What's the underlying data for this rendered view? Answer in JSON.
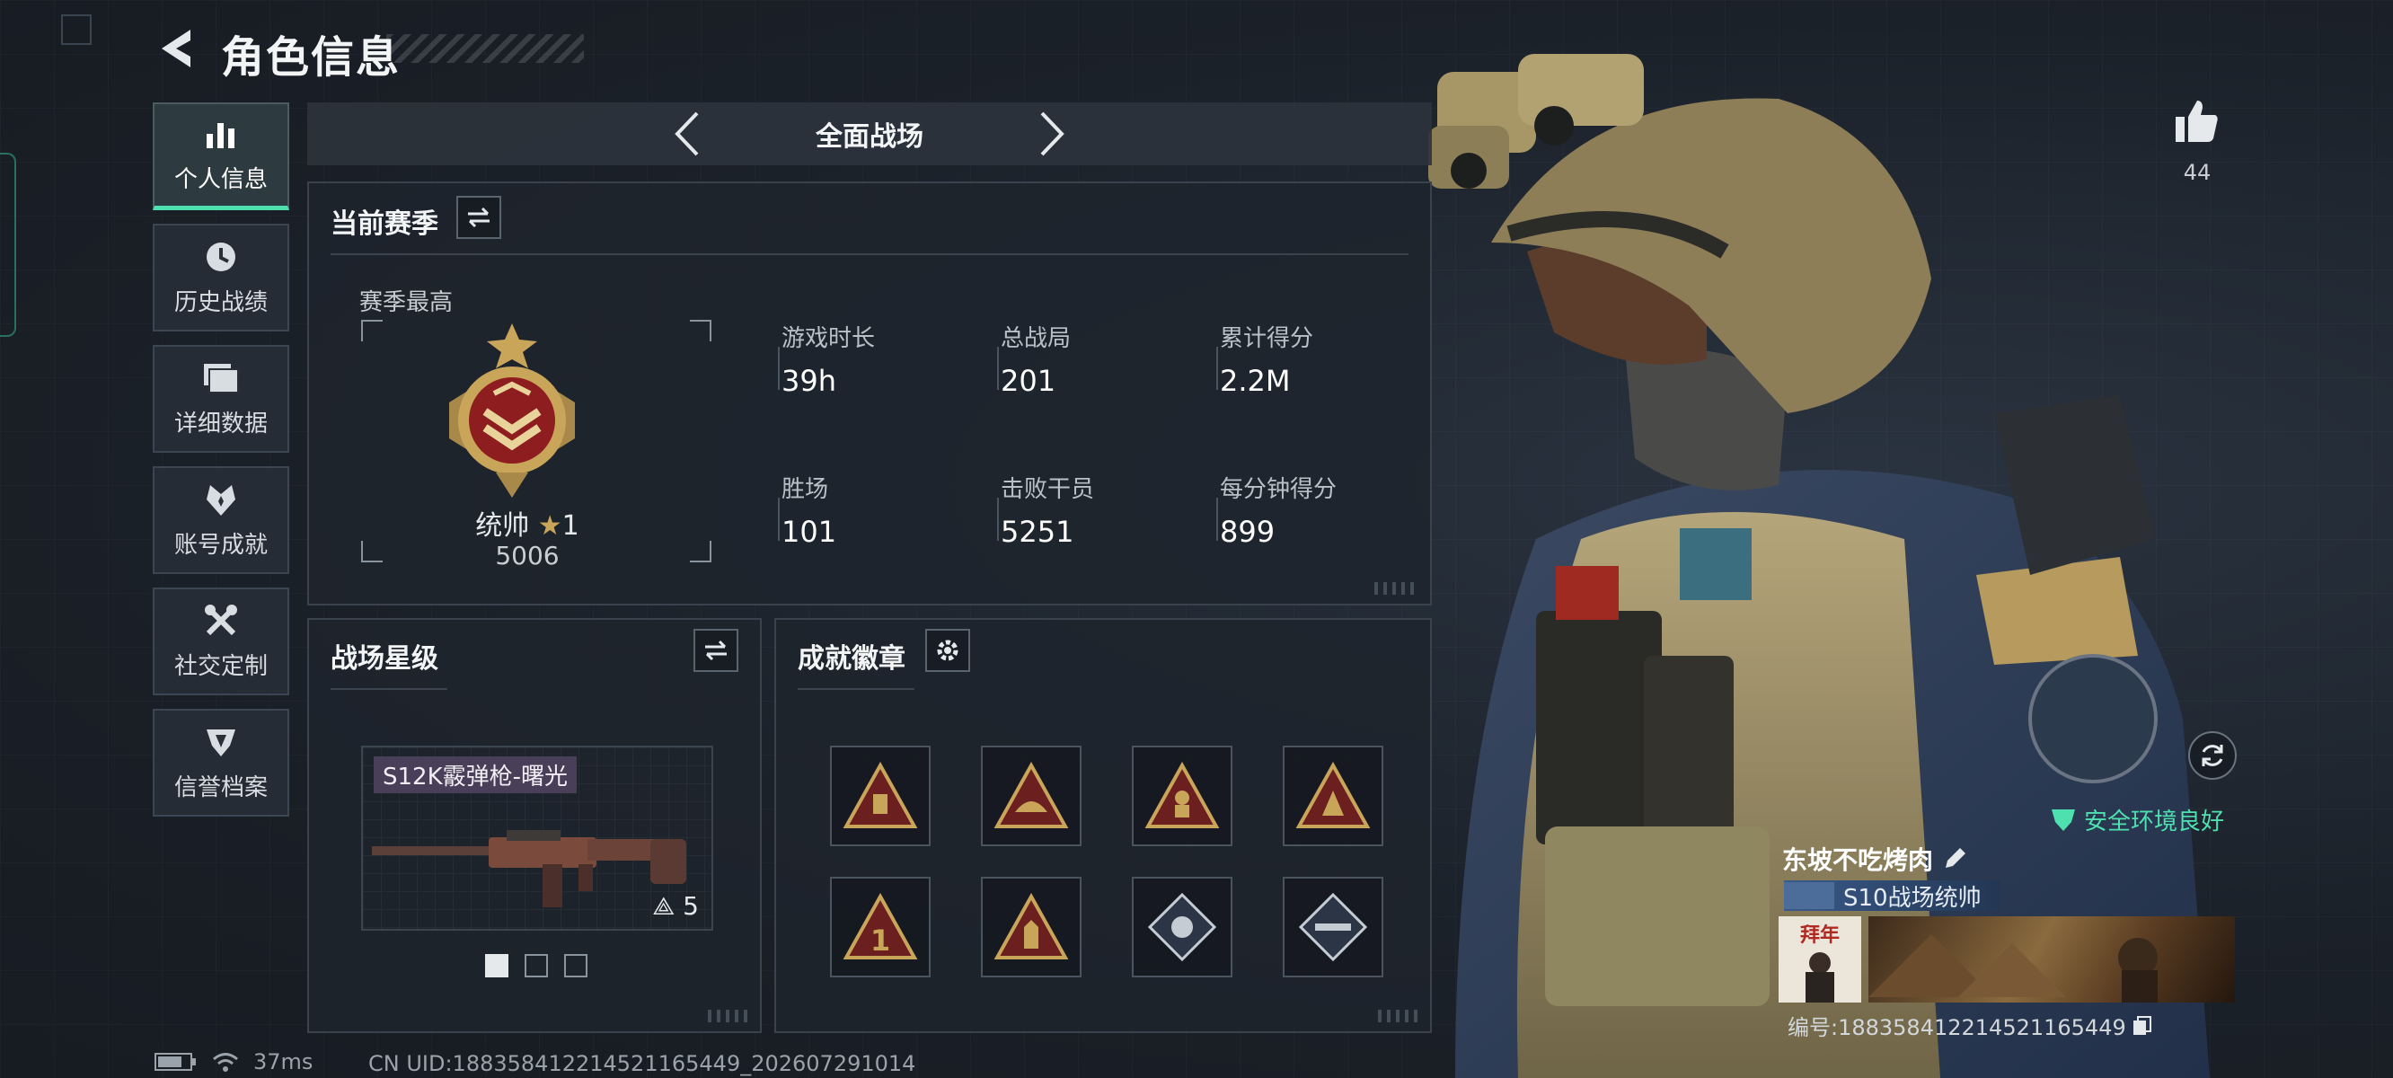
{
  "header": {
    "title": "角色信息"
  },
  "sidebar": {
    "items": [
      {
        "label": "个人信息",
        "icon": "bar-chart-icon",
        "active": true
      },
      {
        "label": "历史战绩",
        "icon": "history-icon"
      },
      {
        "label": "详细数据",
        "icon": "folder-icon"
      },
      {
        "label": "账号成就",
        "icon": "achievement-icon"
      },
      {
        "label": "社交定制",
        "icon": "tools-icon"
      },
      {
        "label": "信誉档案",
        "icon": "reputation-icon"
      }
    ]
  },
  "mode": {
    "label": "全面战场"
  },
  "season": {
    "title": "当前赛季",
    "best_label": "赛季最高",
    "rank_name": "统帅",
    "rank_stars": "1",
    "rank_score": "5006",
    "stats": [
      {
        "label": "游戏时长",
        "value": "39h"
      },
      {
        "label": "总战局",
        "value": "201"
      },
      {
        "label": "累计得分",
        "value": "2.2M"
      },
      {
        "label": "胜场",
        "value": "101"
      },
      {
        "label": "击败干员",
        "value": "5251"
      },
      {
        "label": "每分钟得分",
        "value": "899"
      }
    ]
  },
  "star_level": {
    "title": "战场星级",
    "weapon_name": "S12K霰弹枪-曙光",
    "weapon_level": "5"
  },
  "badges": {
    "title": "成就徽章",
    "count": 8
  },
  "profile": {
    "likes": "44",
    "env_status": "安全环境良好",
    "player_name": "东坡不吃烤肉",
    "player_title": "S10战场统帅",
    "id_text": "编号:188358412214521165449"
  },
  "status_bar": {
    "ping": "37ms",
    "uid": "CN UID:188358412214521165449_202607291014"
  },
  "colors": {
    "accent": "#4fe0b0",
    "gold": "#c9a55a",
    "panel": "#1f252d"
  }
}
